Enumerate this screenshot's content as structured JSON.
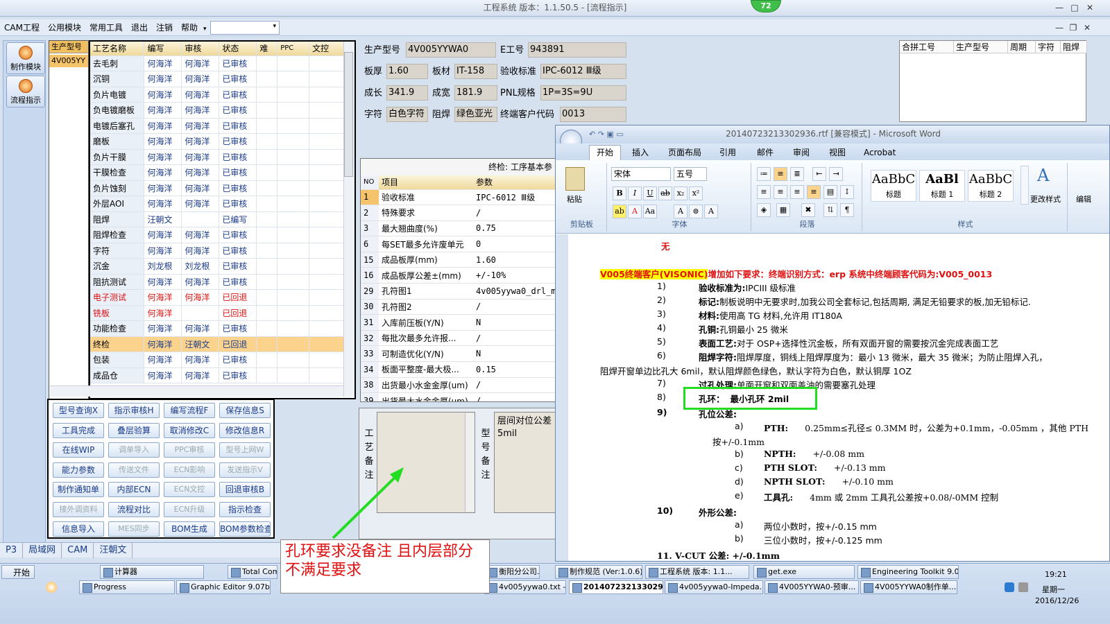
{
  "window": {
    "title": "工程系统   版本：1.1.50.5 - [流程指示]",
    "badge": "72",
    "min": "—",
    "max": "□",
    "close": "✕",
    "mdi_min": "—",
    "mdi_restore": "❐",
    "mdi_close": "✕"
  },
  "menu": [
    "CAM工程",
    "公用模块",
    "常用工具",
    "退出",
    "注销",
    "帮助"
  ],
  "menu_dropdown": "▾",
  "leftnav": [
    {
      "label": "制作模块"
    },
    {
      "label": "流程指示"
    }
  ],
  "model_panel": {
    "header": "生产型号",
    "selected": "4V005YY"
  },
  "process_grid": {
    "headers": [
      "工艺名称",
      "编写",
      "审核",
      "状态",
      "难",
      "PPC",
      "文控"
    ],
    "rows": [
      [
        "去毛刺",
        "何海洋",
        "何海洋",
        "已审核"
      ],
      [
        "沉铜",
        "何海洋",
        "何海洋",
        "已审核"
      ],
      [
        "负片电镀",
        "何海洋",
        "何海洋",
        "已审核"
      ],
      [
        "负电镀磨板",
        "何海洋",
        "何海洋",
        "已审核"
      ],
      [
        "电镀后塞孔",
        "何海洋",
        "何海洋",
        "已审核"
      ],
      [
        "磨板",
        "何海洋",
        "何海洋",
        "已审核"
      ],
      [
        "负片干膜",
        "何海洋",
        "何海洋",
        "已审核"
      ],
      [
        "干膜检查",
        "何海洋",
        "何海洋",
        "已审核"
      ],
      [
        "负片蚀刻",
        "何海洋",
        "何海洋",
        "已审核"
      ],
      [
        "外层AOI",
        "何海洋",
        "何海洋",
        "已审核"
      ],
      [
        "阻焊",
        "汪朝文",
        "",
        "已编写"
      ],
      [
        "阻焊检查",
        "何海洋",
        "何海洋",
        "已审核"
      ],
      [
        "字符",
        "何海洋",
        "何海洋",
        "已审核"
      ],
      [
        "沉金",
        "刘龙根",
        "刘龙根",
        "已审核"
      ],
      [
        "阻抗测试",
        "何海洋",
        "何海洋",
        "已审核"
      ],
      [
        "电子测试",
        "何海洋",
        "何海洋",
        "已回退"
      ],
      [
        "铣板",
        "何海洋",
        "",
        "已回退"
      ],
      [
        "功能检查",
        "何海洋",
        "何海洋",
        "已审核"
      ],
      [
        "终检",
        "何海洋",
        "汪朝文",
        "已回退"
      ],
      [
        "包装",
        "何海洋",
        "何海洋",
        "已审核"
      ],
      [
        "成品仓",
        "何海洋",
        "何海洋",
        "已审核"
      ]
    ],
    "red_rows": [
      15,
      16
    ],
    "selected_row": 18
  },
  "buttons": [
    [
      "型号查询X",
      "指示审核H",
      "编写流程F",
      "保存信息S"
    ],
    [
      "工具完成",
      "叠层验算",
      "取消修改C",
      "修改信息R"
    ],
    [
      "在线WIP",
      "调单导入",
      "PPC审核",
      "型号上网W"
    ],
    [
      "能力参数",
      "传送文件",
      "ECN影响",
      "发送指示V"
    ],
    [
      "制作通知单",
      "内部ECN",
      "ECN文控",
      "回退审核B"
    ],
    [
      "接外调资料",
      "流程对比",
      "ECN升级",
      "指示检查"
    ],
    [
      "信息导入",
      "MES同步",
      "BOM生成",
      "BOM参数检查"
    ]
  ],
  "disabled_buttons": [
    "调单导入",
    "PPC审核",
    "型号上网W",
    "传送文件",
    "ECN影响",
    "发送指示V",
    "ECN文控",
    "接外调资料",
    "ECN升级",
    "MES同步"
  ],
  "info": {
    "model_lbl": "生产型号",
    "model": "4V005YYWA0",
    "eng_lbl": "E工号",
    "eng": "943891",
    "thick_lbl": "板厚",
    "thick": "1.60",
    "mat_lbl": "板材",
    "mat": "IT-158",
    "std_lbl": "验收标准",
    "std": "IPC-6012 Ⅲ级",
    "len_lbl": "成长",
    "len": "341.9",
    "wid_lbl": "成宽",
    "wid": "181.9",
    "pnl_lbl": "PNL规格",
    "pnl": "1P=3S=9U",
    "char_lbl": "字符",
    "char": "白色字符",
    "mask_lbl": "阻焊",
    "mask": "绿色亚光",
    "cust_lbl": "终端客户代码",
    "cust": "0013"
  },
  "param_grid": {
    "caption": "终检: 工序基本参",
    "headers": [
      "NO",
      "项目",
      "参数"
    ],
    "rows": [
      [
        "1",
        "验收标准",
        "IPC-6012 Ⅲ级"
      ],
      [
        "2",
        "特殊要求",
        "/"
      ],
      [
        "3",
        "最大翘曲度(%)",
        "0.75"
      ],
      [
        "6",
        "每SET最多允许废单元",
        "0"
      ],
      [
        "15",
        "成品板厚(mm)",
        "1.60"
      ],
      [
        "16",
        "成品板厚公差±(mm)",
        "+/-10%"
      ],
      [
        "29",
        "孔符图1",
        "4v005yywa0_drl_m"
      ],
      [
        "30",
        "孔符图2",
        "/"
      ],
      [
        "31",
        "入库前压板(Y/N)",
        "N"
      ],
      [
        "32",
        "每批次最多允许报...",
        "/"
      ],
      [
        "33",
        "可制造优化(Y/N)",
        "N"
      ],
      [
        "34",
        "板面平整度-最大极...",
        "0.15"
      ],
      [
        "38",
        "出货最小水金金厚(um)",
        "/"
      ],
      [
        "39",
        "出货最大水金金厚(um)",
        "/"
      ]
    ]
  },
  "remarks": {
    "proc_label": "工艺备注",
    "model_label": "型号备注",
    "model_text": "层间对位公差5mil"
  },
  "right_table": {
    "headers": [
      "合拼工号",
      "生产型号",
      "周期",
      "字符",
      "阻焊"
    ]
  },
  "word": {
    "title": "20140723213302936.rtf [兼容模式] - Microsoft Word",
    "tabs": [
      "开始",
      "插入",
      "页面布局",
      "引用",
      "邮件",
      "审阅",
      "视图",
      "Acrobat"
    ],
    "groups": [
      "剪贴板",
      "字体",
      "段落",
      "样式"
    ],
    "paste": "粘贴",
    "font_name": "宋体",
    "font_size": "五号",
    "styles": [
      {
        "sample": "AaBbC",
        "name": "标题"
      },
      {
        "sample": "AaBl",
        "name": "标题 1"
      },
      {
        "sample": "AaBbC",
        "name": "标题 2"
      }
    ],
    "change_style": "更改样式",
    "edit": "编辑",
    "doc": {
      "none": "无",
      "heading_prefix": "V005终端客户(VISONIC)",
      "heading_rest": "增加如下要求：终端识别方式：erp 系统中终端顾客代码为:V005_0013",
      "items": [
        {
          "n": "1)",
          "t": "验收标准为:",
          "d": "IPCIII 级标准"
        },
        {
          "n": "2)",
          "t": "标记:",
          "d": "制板说明中无要求时,加我公司全套标记,包括周期, 满足无铅要求的板,加无铅标记."
        },
        {
          "n": "3)",
          "t": "材料:",
          "d": "使用高 TG 材料,允许用 IT180A"
        },
        {
          "n": "4)",
          "t": "孔铜:",
          "d": "孔铜最小 25 微米"
        },
        {
          "n": "5)",
          "t": "表面工艺:",
          "d": "对于 OSP+选择性沉金板，所有双面开窗的需要按沉金完成表面工艺"
        },
        {
          "n": "6)",
          "t": "阻焊字符:",
          "d": "阻焊厚度，铜线上阻焊厚度为：最小 13 微米，最大 35 微米；为防止阻焊入孔，"
        },
        {
          "n": "",
          "t": "",
          "d": "阻焊开窗单边比孔大 6mil，默认阻焊颜色绿色，默认字符为白色，默认铜厚 1OZ"
        },
        {
          "n": "7)",
          "t": "过孔处理:",
          "d": "单面开窗和双面盖油的需要塞孔处理"
        },
        {
          "n": "8)",
          "t": "孔环：",
          "d": "最小孔环 2mil"
        },
        {
          "n": "9)",
          "t": "孔位公差:",
          "d": ""
        }
      ],
      "sub9": [
        {
          "n": "a)",
          "t": "PTH:",
          "d": "0.25mm≤孔径≤ 0.3MM 时，公差为+0.1mm，-0.05mm ，其他 PTH"
        },
        {
          "n": "",
          "t": "",
          "d": "按+/-0.1mm"
        },
        {
          "n": "b)",
          "t": "NPTH:",
          "d": "+/-0.08 mm"
        },
        {
          "n": "c)",
          "t": "PTH SLOT:",
          "d": "+/-0.13 mm"
        },
        {
          "n": "d)",
          "t": "NPTH SLOT:",
          "d": "+/-0.10 mm"
        },
        {
          "n": "e)",
          "t": "工具孔:",
          "d": "4mm 或 2mm 工具孔公差按+0.08/-0MM 控制"
        }
      ],
      "item10": {
        "n": "10)",
        "t": "外形公差:"
      },
      "sub10": [
        {
          "n": "a)",
          "d": "两位小数时，按+/-0.15 mm"
        },
        {
          "n": "b)",
          "d": "三位小数时，按+/-0.125 mm"
        }
      ],
      "item11": "11. V-CUT 公差: +/-0.1mm"
    }
  },
  "bottom_tabs": [
    "P3",
    "局域网",
    "CAM",
    "汪朝文"
  ],
  "annotation": "孔环要求没备注  且内层部分不满足要求",
  "taskbar": {
    "start": "开始",
    "row1": [
      "计算器",
      "Total Comm",
      "衡阳分公司...",
      "制作规范 (Ver:1.0.6)",
      "工程系统 版本: 1.1...",
      "get.exe",
      "Engineering Toolkit 9.0..."
    ],
    "row2": [
      "Progress",
      "Graphic Editor 9.07b...",
      "4v005yywa0.txt - 写...",
      "201407232133029...",
      "4v005yywa0-Impeda...",
      "4V005YYWA0-预审...",
      "4V005YYWA0制作单..."
    ],
    "time": "19:21",
    "weekday": "星期一",
    "date": "2016/12/26"
  },
  "colors": {
    "selected_row": "#fbd38d",
    "red_text": "#e01010",
    "highlight_box": "#22dd22",
    "doc_red": "#e01010",
    "doc_yellow": "#ffff00"
  }
}
